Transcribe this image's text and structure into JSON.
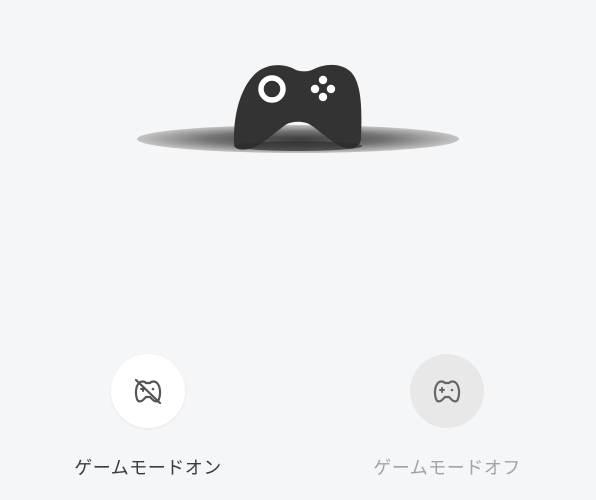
{
  "hero": {
    "icon": "gamepad-illustration"
  },
  "modes": {
    "on": {
      "label": "ゲームモードオン",
      "icon": "gamepad-off-icon",
      "selected": true
    },
    "off": {
      "label": "ゲームモードオフ",
      "icon": "gamepad-icon",
      "selected": false
    }
  },
  "colors": {
    "background": "#f5f6f8",
    "controller": "#333333",
    "active_text": "#3a3a3a",
    "inactive_text": "#a3a3a3"
  }
}
